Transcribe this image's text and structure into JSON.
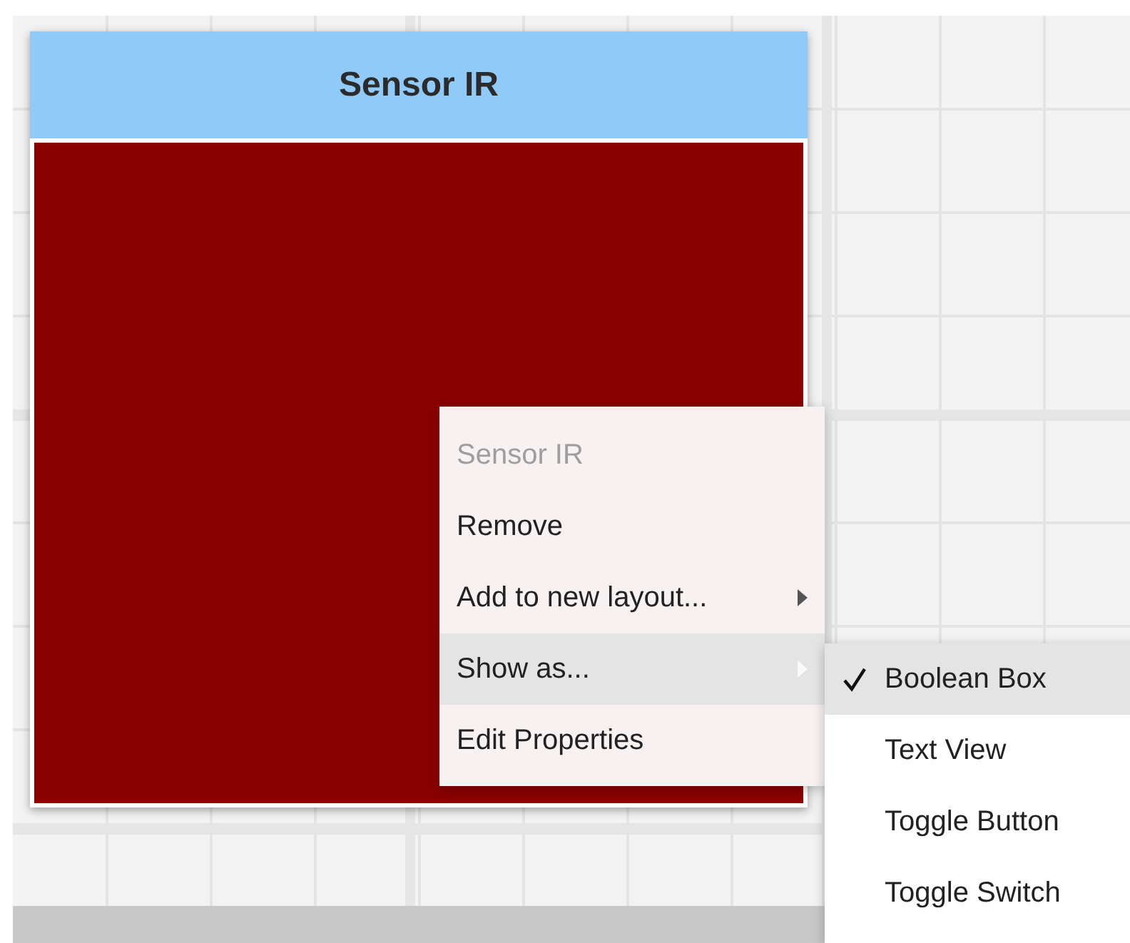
{
  "widget": {
    "title": "Sensor IR",
    "value": false
  },
  "context_menu": {
    "title": "Sensor IR",
    "items": [
      {
        "label": "Remove",
        "has_submenu": false,
        "selected": false
      },
      {
        "label": "Add to new layout...",
        "has_submenu": true,
        "selected": false
      },
      {
        "label": "Show as...",
        "has_submenu": true,
        "selected": true
      },
      {
        "label": "Edit Properties",
        "has_submenu": false,
        "selected": false
      }
    ]
  },
  "submenu": {
    "items": [
      {
        "label": "Boolean Box",
        "checked": true,
        "selected": true
      },
      {
        "label": "Text View",
        "checked": false,
        "selected": false
      },
      {
        "label": "Toggle Button",
        "checked": false,
        "selected": false
      },
      {
        "label": "Toggle Switch",
        "checked": false,
        "selected": false
      }
    ]
  }
}
